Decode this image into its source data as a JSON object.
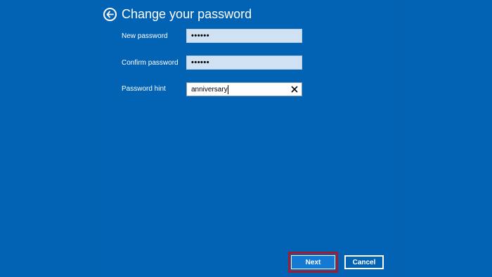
{
  "header": {
    "title": "Change your password",
    "back_icon": "back-arrow-icon"
  },
  "form": {
    "new_password": {
      "label": "New password",
      "value": "••••••"
    },
    "confirm_password": {
      "label": "Confirm password",
      "value": "••••••"
    },
    "password_hint": {
      "label": "Password hint",
      "value": "anniversary",
      "clear_icon": "close-icon"
    }
  },
  "footer": {
    "next_label": "Next",
    "cancel_label": "Cancel"
  },
  "colors": {
    "background": "#0263b5",
    "highlight_frame": "#a01c2e",
    "password_field": "#cfe1f2"
  }
}
